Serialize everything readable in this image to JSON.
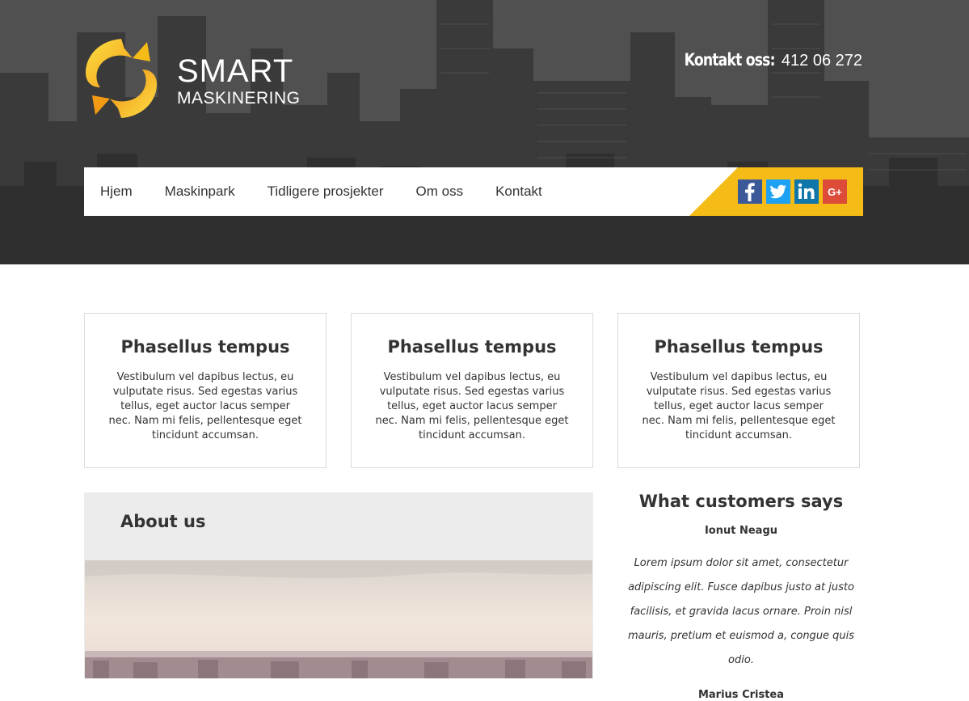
{
  "brand": {
    "name_main": "SMART",
    "name_sub": "MASKINERING",
    "accent_color": "#f5bb16"
  },
  "header": {
    "contact_label": "Kontakt oss:",
    "contact_phone": "412 06 272"
  },
  "nav": {
    "items": [
      {
        "label": "Hjem"
      },
      {
        "label": "Maskinpark"
      },
      {
        "label": "Tidligere prosjekter"
      },
      {
        "label": "Om oss"
      },
      {
        "label": "Kontakt"
      }
    ]
  },
  "social": {
    "icons": [
      {
        "name": "facebook-icon",
        "glyph": "f"
      },
      {
        "name": "twitter-icon",
        "glyph": "t"
      },
      {
        "name": "linkedin-icon",
        "glyph": "in"
      },
      {
        "name": "google-plus-icon",
        "glyph": "G+"
      }
    ]
  },
  "features": [
    {
      "title": "Phasellus tempus",
      "text": "Vestibulum vel dapibus lectus, eu vulputate risus. Sed egestas varius tellus, eget auctor lacus semper nec. Nam mi felis, pellentesque eget tincidunt accumsan."
    },
    {
      "title": "Phasellus tempus",
      "text": "Vestibulum vel dapibus lectus, eu vulputate risus. Sed egestas varius tellus, eget auctor lacus semper nec. Nam mi felis, pellentesque eget tincidunt accumsan."
    },
    {
      "title": "Phasellus tempus",
      "text": "Vestibulum vel dapibus lectus, eu vulputate risus. Sed egestas varius tellus, eget auctor lacus semper nec. Nam mi felis, pellentesque eget tincidunt accumsan."
    }
  ],
  "about": {
    "title": "About us"
  },
  "testimonials": {
    "title": "What customers says",
    "items": [
      {
        "author": "Ionut Neagu",
        "quote": "Lorem ipsum dolor sit amet, consectetur adipiscing elit. Fusce dapibus justo at justo facilisis, et gravida lacus ornare. Proin nisl mauris, pretium et euismod a, congue quis odio."
      },
      {
        "author": "Marius Cristea"
      }
    ]
  }
}
